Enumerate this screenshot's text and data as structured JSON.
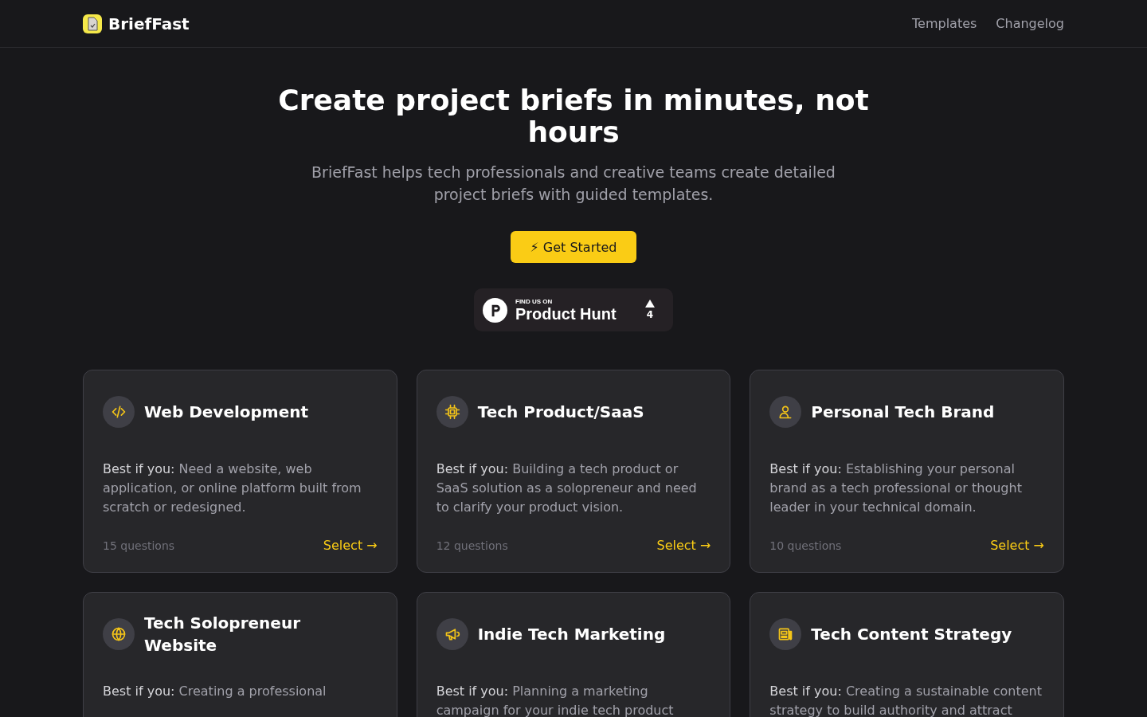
{
  "header": {
    "brand": "BriefFast",
    "nav": [
      "Templates",
      "Changelog"
    ]
  },
  "hero": {
    "title": "Create project briefs in minutes, not hours",
    "subtitle": "BriefFast helps tech professionals and creative teams create detailed project briefs with guided templates.",
    "cta": "⚡ Get Started"
  },
  "badge": {
    "kicker": "FIND US ON",
    "name": "Product Hunt",
    "votes": "4"
  },
  "templates": [
    {
      "title": "Web Development",
      "lead": "Best if you:",
      "text": "Need a website, web application, or online platform built from scratch or redesigned.",
      "questions": "15 questions",
      "action": "Select →"
    },
    {
      "title": "Tech Product/SaaS",
      "lead": "Best if you:",
      "text": "Building a tech product or SaaS solution as a solopreneur and need to clarify your product vision.",
      "questions": "12 questions",
      "action": "Select →"
    },
    {
      "title": "Personal Tech Brand",
      "lead": "Best if you:",
      "text": "Establishing your personal brand as a tech professional or thought leader in your technical domain.",
      "questions": "10 questions",
      "action": "Select →"
    },
    {
      "title": "Tech Solopreneur Website",
      "lead": "Best if you:",
      "text": "Creating a professional"
    },
    {
      "title": "Indie Tech Marketing",
      "lead": "Best if you:",
      "text": "Planning a marketing campaign for your indie tech product"
    },
    {
      "title": "Tech Content Strategy",
      "lead": "Best if you:",
      "text": "Creating a sustainable content strategy to build authority and attract"
    }
  ]
}
